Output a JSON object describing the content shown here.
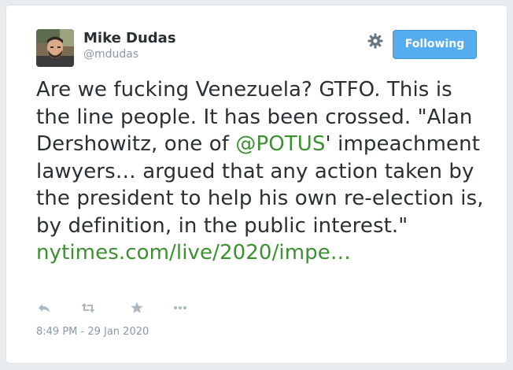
{
  "author": {
    "name": "Mike Dudas",
    "handle": "@mdudas"
  },
  "follow_button": {
    "label": "Following"
  },
  "tweet": {
    "text_part1": "Are we fucking Venezuela? GTFO. This is the line people. It has been crossed. \"Alan Dershowitz, one of ",
    "mention": "@POTUS",
    "text_part2": "' impeachment lawyers… argued that any action taken by the president to help his own re-election is, by definition, in the public interest.\" ",
    "link": "nytimes.com/live/2020/impe…"
  },
  "timestamp": "8:49 PM - 29 Jan 2020",
  "icons": {
    "settings": "gear-icon",
    "reply": "reply-icon",
    "retweet": "retweet-icon",
    "like": "star-icon",
    "more": "more-icon"
  },
  "colors": {
    "link": "#3b9130",
    "button": "#55acee",
    "muted": "#8899a6",
    "text": "#292f33"
  }
}
